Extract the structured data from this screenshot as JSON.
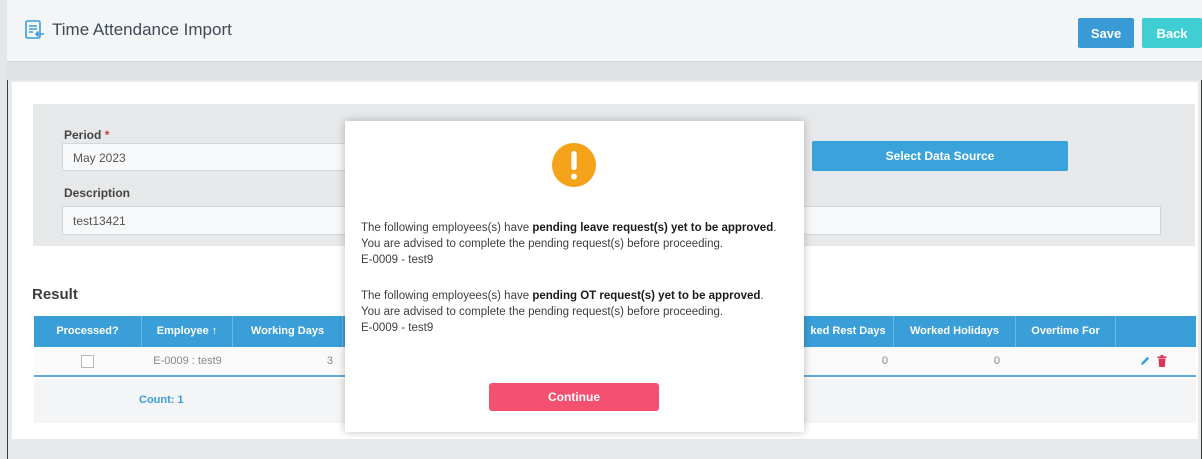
{
  "header": {
    "title": "Time Attendance Import",
    "save_label": "Save",
    "back_label": "Back"
  },
  "form": {
    "period_label": "Period",
    "period_required": "*",
    "period_value": "May 2023",
    "description_label": "Description",
    "description_value": "test13421",
    "select_source_label": "Select Data Source"
  },
  "result": {
    "title": "Result",
    "columns": [
      "Processed?",
      "Employee",
      "Working Days",
      "ked Rest Days",
      "Worked Holidays",
      "Overtime For"
    ],
    "sort_indicator": "↑",
    "rows": [
      {
        "employee": "E-0009 : test9",
        "working_days": "3",
        "worked_rest_days": "0",
        "worked_holidays": "0"
      }
    ],
    "count_label": "Count: 1"
  },
  "modal": {
    "leave_prefix": "The following employees(s) have ",
    "leave_bold": "pending leave request(s) yet to be approved",
    "leave_suffix": ".",
    "advice_1": "You are advised to complete the pending request(s) before proceeding.",
    "employee_1": "E-0009 - test9",
    "ot_prefix": "The following employees(s) have ",
    "ot_bold": "pending OT request(s) yet to be approved",
    "ot_suffix": ".",
    "advice_2": "You are advised to complete the pending request(s) before proceeding.",
    "employee_2": "E-0009 - test9",
    "continue_label": "Continue"
  },
  "colors": {
    "primary": "#3a9ed8",
    "back": "#3fcfd3",
    "continue": "#f4506f",
    "warning": "#f5a21b",
    "delete": "#e0335a"
  }
}
